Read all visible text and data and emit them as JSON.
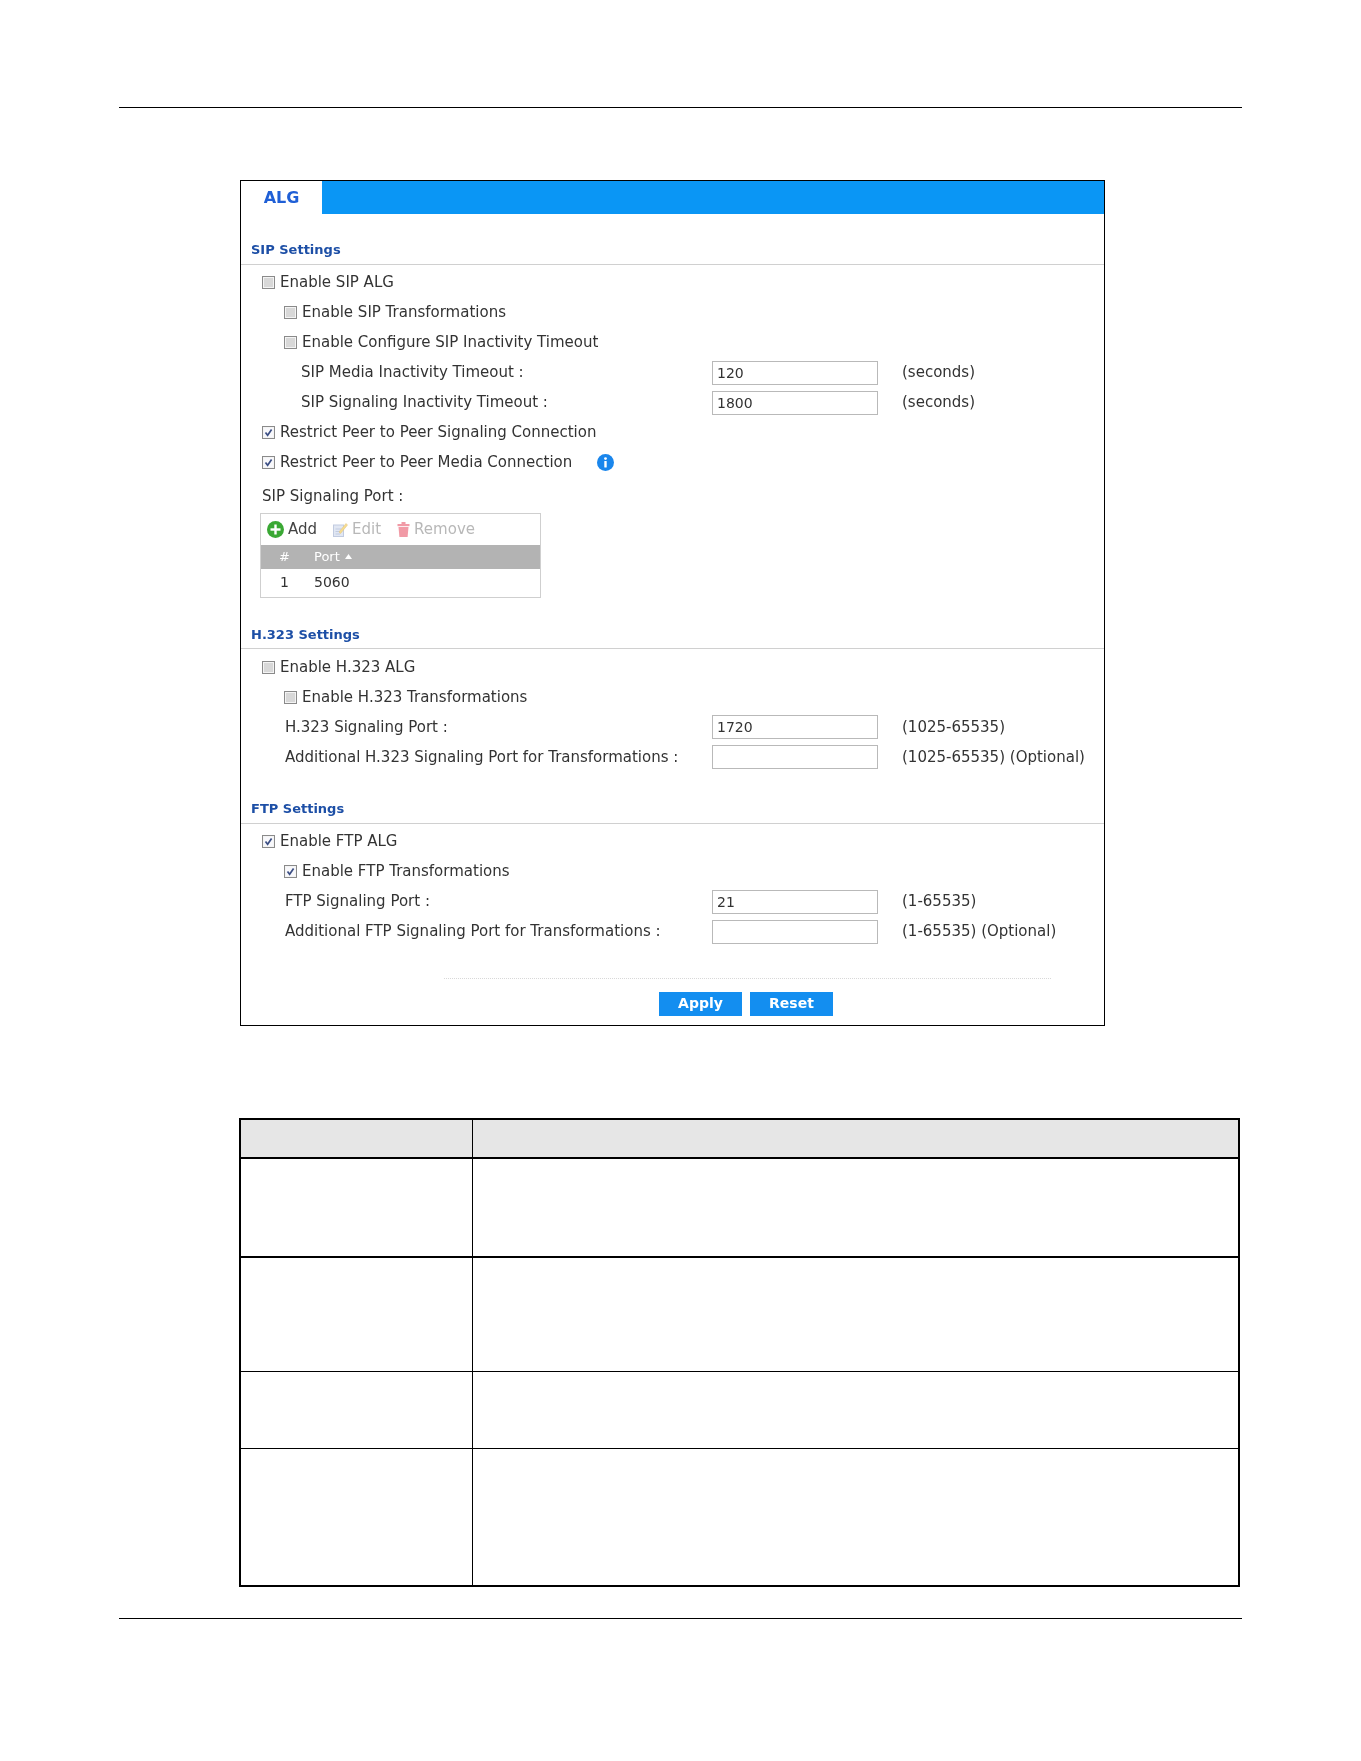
{
  "tabs": [
    {
      "label": "ALG",
      "selected": true
    }
  ],
  "sections": [
    {
      "title": "SIP Settings",
      "items": [
        {
          "kind": "checkbox",
          "label": "Enable SIP ALG",
          "checked": false,
          "children": [
            {
              "kind": "checkbox",
              "label": "Enable SIP Transformations",
              "checked": false
            },
            {
              "kind": "checkbox",
              "label": "Enable Configure SIP Inactivity Timeout",
              "checked": false,
              "children": [
                {
                  "kind": "field",
                  "label": "SIP Media Inactivity Timeout :",
                  "value": "120",
                  "hint": "(seconds)"
                },
                {
                  "kind": "field",
                  "label": "SIP Signaling Inactivity Timeout :",
                  "value": "1800",
                  "hint": "(seconds)"
                }
              ]
            }
          ]
        },
        {
          "kind": "checkbox",
          "label": "Restrict Peer to Peer Signaling Connection",
          "checked": true
        },
        {
          "kind": "checkbox",
          "label": "Restrict Peer to Peer Media Connection",
          "checked": true,
          "info": true
        },
        {
          "kind": "port_table",
          "label": "SIP Signaling Port :",
          "toolbar": [
            {
              "kind": "add",
              "label": "Add",
              "disabled": false
            },
            {
              "kind": "edit",
              "label": "Edit",
              "disabled": true
            },
            {
              "kind": "remove",
              "label": "Remove",
              "disabled": true
            }
          ],
          "columns": [
            {
              "label": "#",
              "sorted": false
            },
            {
              "label": "Port",
              "sorted": true
            }
          ],
          "rows": [
            [
              "1",
              "5060"
            ]
          ]
        }
      ]
    },
    {
      "title": "H.323 Settings",
      "items": [
        {
          "kind": "checkbox",
          "label": "Enable H.323 ALG",
          "checked": false,
          "children": [
            {
              "kind": "checkbox",
              "label": "Enable H.323 Transformations",
              "checked": false
            },
            {
              "kind": "field",
              "label": "H.323 Signaling Port :",
              "value": "1720",
              "hint": "(1025-65535)"
            },
            {
              "kind": "field",
              "label": "Additional H.323 Signaling Port for Transformations :",
              "hint": "(1025-65535) (Optional)"
            }
          ]
        }
      ]
    },
    {
      "title": "FTP Settings",
      "items": [
        {
          "kind": "checkbox",
          "label": "Enable FTP ALG",
          "checked": true,
          "children": [
            {
              "kind": "checkbox",
              "label": "Enable FTP Transformations",
              "checked": true
            },
            {
              "kind": "field",
              "label": "FTP Signaling Port :",
              "value": "21",
              "hint": "(1-65535)"
            },
            {
              "kind": "field",
              "label": "Additional FTP Signaling Port for Transformations :",
              "hint": "(1-65535) (Optional)"
            }
          ]
        }
      ]
    }
  ],
  "buttons": [
    "Apply",
    "Reset"
  ]
}
